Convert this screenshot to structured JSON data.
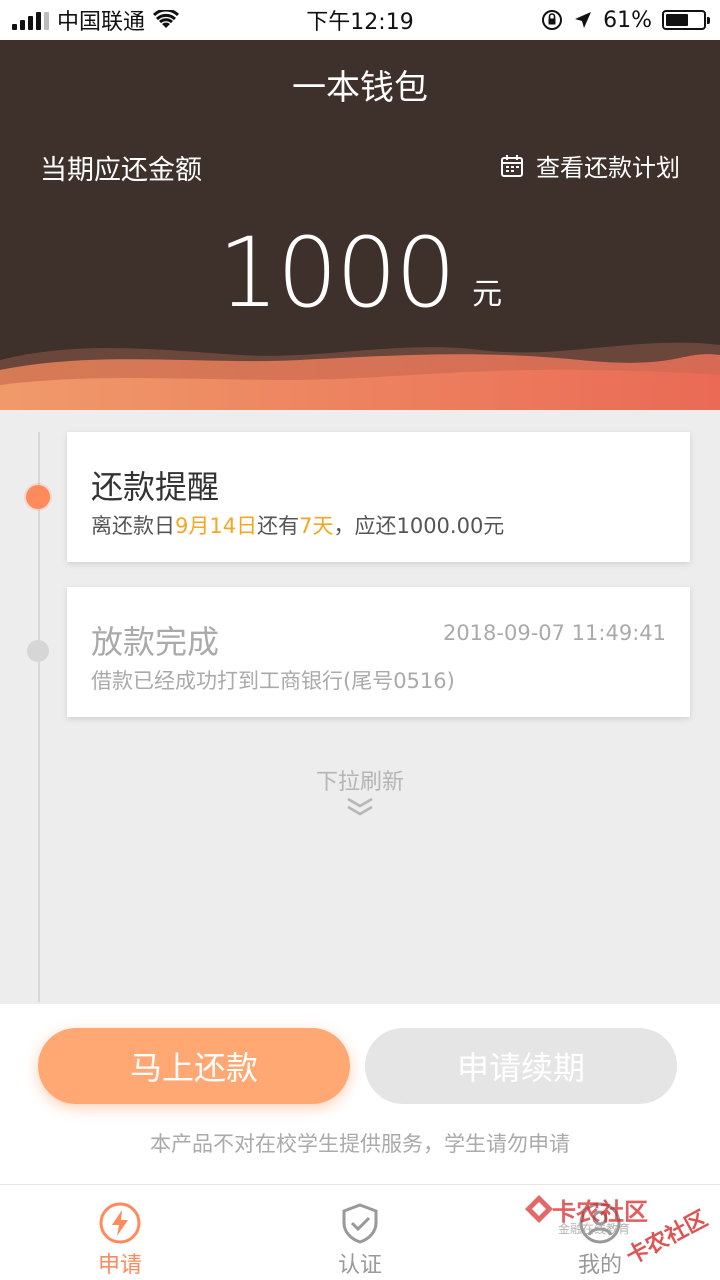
{
  "status_bar": {
    "carrier": "中国联通",
    "time": "下午12:19",
    "battery_percent": "61%",
    "battery_level": 0.61
  },
  "header": {
    "title": "一本钱包",
    "due_label": "当期应还金额",
    "plan_link": "查看还款计划",
    "amount": "1000",
    "amount_unit": "元",
    "background_color": "#3e302b"
  },
  "timeline": {
    "items": [
      {
        "title": "还款提醒",
        "desc_prefix": "离还款日",
        "desc_date": "9月14日",
        "desc_mid": "还有",
        "desc_days": "7天",
        "desc_suffix": "，应还1000.00元",
        "active": true
      },
      {
        "title": "放款完成",
        "time": "2018-09-07 11:49:41",
        "desc": "借款已经成功打到工商银行(尾号0516)",
        "active": false
      }
    ],
    "pull_refresh": "下拉刷新"
  },
  "actions": {
    "pay_label": "马上还款",
    "extend_label": "申请续期",
    "notice": "本产品不对在校学生提供服务，学生请勿申请"
  },
  "tabbar": {
    "tabs": [
      {
        "label": "申请",
        "icon": "lightning-icon",
        "active": true
      },
      {
        "label": "认证",
        "icon": "shield-check-icon",
        "active": false
      },
      {
        "label": "我的",
        "icon": "user-icon",
        "active": false
      }
    ]
  },
  "watermark": {
    "line1": "卡农社区",
    "line2": "金融在线教育",
    "line3": "卡农社区"
  },
  "colors": {
    "accent": "#ff8a5c",
    "highlight": "#f5a623",
    "pay_button": "#ffa874"
  }
}
